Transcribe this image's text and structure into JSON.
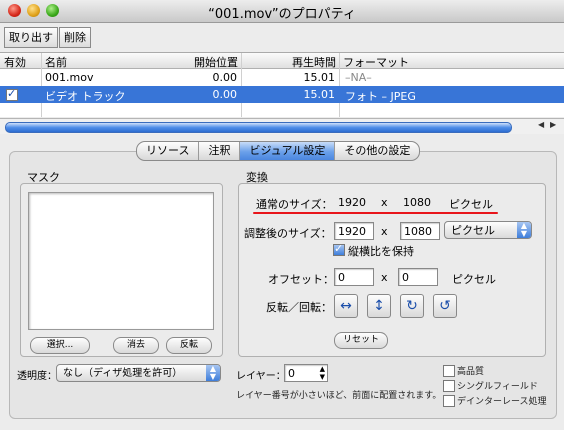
{
  "window": {
    "title": "“001.mov”のプロパティ"
  },
  "toolbar": {
    "extract_label": "取り出す",
    "delete_label": "削除"
  },
  "table": {
    "headers": {
      "enabled": "有効",
      "name": "名前",
      "start": "開始位置",
      "duration": "再生時間",
      "format": "フォーマット"
    },
    "rows": [
      {
        "name": "001.mov",
        "start": "0.00",
        "duration": "15.01",
        "format": "–NA–"
      },
      {
        "name": "ビデオ トラック",
        "start": "0.00",
        "duration": "15.01",
        "format": "フォト – JPEG"
      }
    ]
  },
  "tabs": [
    "リソース",
    "注釈",
    "ビジュアル設定",
    "その他の設定"
  ],
  "mask": {
    "label": "マスク",
    "select": "選択...",
    "erase": "消去",
    "invert": "反転"
  },
  "transform": {
    "label": "変換",
    "normal_size_label": "通常のサイズ：",
    "normal_w": "1920",
    "x": "x",
    "normal_h": "1080",
    "unit": "ピクセル",
    "adjusted_label": "調整後のサイズ：",
    "adjusted_w": "1920",
    "adjusted_h": "1080",
    "adjusted_unit": "ピクセル",
    "keep_aspect": "縦横比を保持",
    "offset_label": "オフセット：",
    "offset_x": "0",
    "offset_y": "0",
    "offset_unit": "ピクセル",
    "flip_label": "反転／回転：",
    "reset": "リセット"
  },
  "bottom": {
    "transparency_label": "透明度：",
    "transparency_value": "なし（ディザ処理を許可）",
    "layer_label": "レイヤー：",
    "layer_value": "0",
    "layer_hint": "レイヤー番号が小さいほど、前面に配置されます。",
    "high_quality": "高品質",
    "single_field": "シングルフィールド",
    "deinterlace": "デインターレース処理"
  },
  "colors": {
    "selection": "#3875d7",
    "annotation": "#e8151b"
  }
}
